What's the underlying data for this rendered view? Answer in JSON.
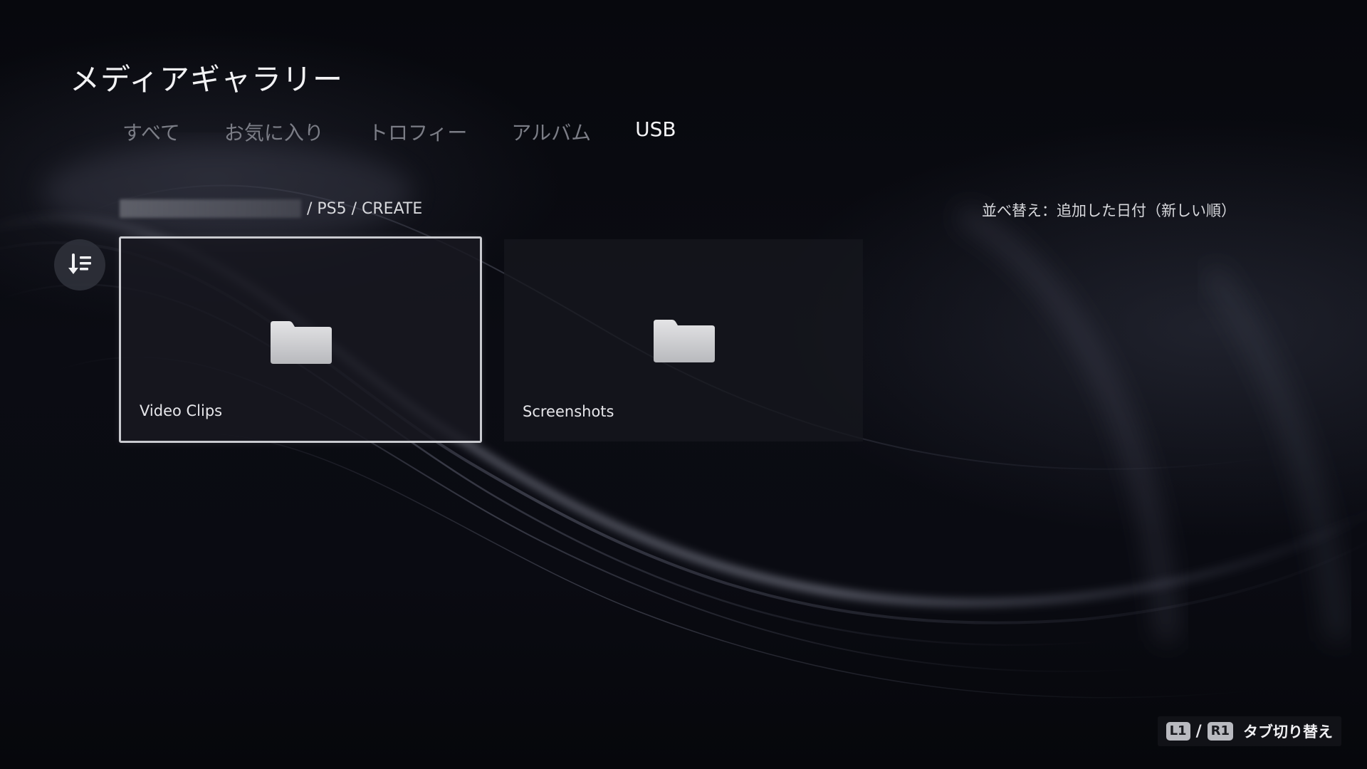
{
  "header": {
    "title": "メディアギャラリー"
  },
  "tabs": [
    {
      "label": "すべて",
      "active": false
    },
    {
      "label": "お気に入り",
      "active": false
    },
    {
      "label": "トロフィー",
      "active": false
    },
    {
      "label": "アルバム",
      "active": false
    },
    {
      "label": "USB",
      "active": true
    }
  ],
  "breadcrumb": {
    "path": "/ PS5 / CREATE"
  },
  "sort": {
    "label": "並べ替え：追加した日付（新しい順）",
    "icon": "sort-descending-icon"
  },
  "folders": [
    {
      "label": "Video Clips",
      "icon": "folder-icon",
      "focused": true
    },
    {
      "label": "Screenshots",
      "icon": "folder-icon",
      "focused": false
    }
  ],
  "footer_hint": {
    "left_button": "L1",
    "separator": "/",
    "right_button": "R1",
    "text": "タブ切り替え"
  },
  "colors": {
    "background": "#06070c",
    "tab_inactive": "#7b7d86",
    "tab_active": "#f4f4f6",
    "focus_border": "#c9cacf"
  }
}
